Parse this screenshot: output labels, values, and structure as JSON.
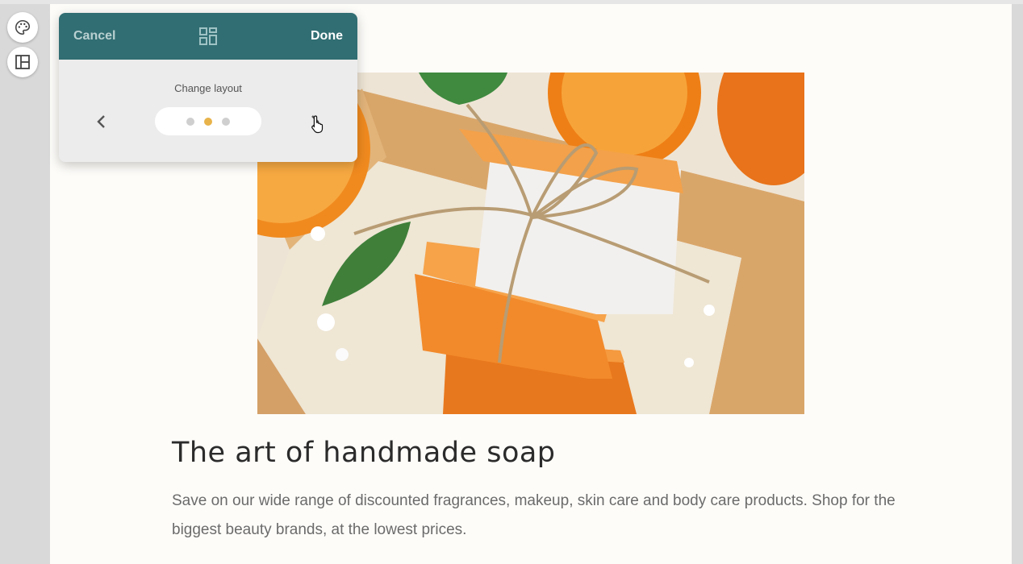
{
  "sidebar": {
    "tools": [
      {
        "name": "palette-tool",
        "icon": "palette-icon"
      },
      {
        "name": "layout-tool",
        "icon": "layout-icon"
      }
    ]
  },
  "popup": {
    "cancel_label": "Cancel",
    "done_label": "Done",
    "header_icon": "layout-grid-icon",
    "label": "Change layout",
    "layout_count": 3,
    "active_layout_index": 1,
    "accent_color": "#316e73",
    "active_dot_color": "#e8b34a"
  },
  "content": {
    "title": "The art of handmade soap",
    "description": "Save on our wide range of discounted fragrances, makeup, skin care and body care products. Shop for the biggest beauty brands, at the lowest prices."
  }
}
